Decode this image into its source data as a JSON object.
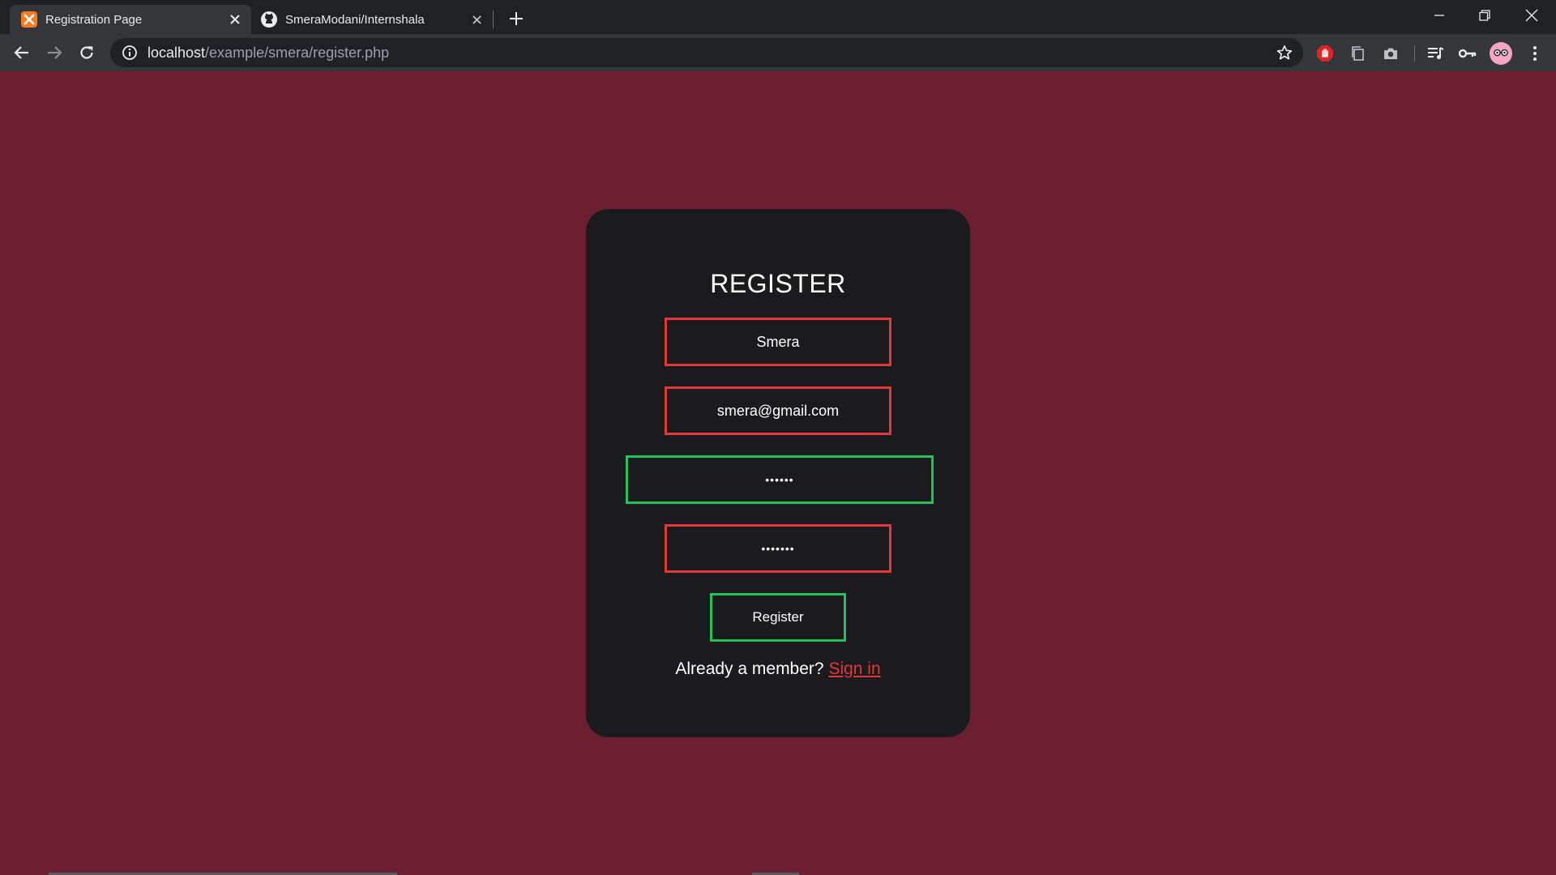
{
  "browser": {
    "tabs": [
      {
        "title": "Registration Page",
        "active": true,
        "favicon": "xampp-icon"
      },
      {
        "title": "SmeraModani/Internshala",
        "active": false,
        "favicon": "github-icon"
      }
    ],
    "address": {
      "host": "localhost",
      "path": "/example/smera/register.php"
    }
  },
  "page": {
    "heading": "REGISTER",
    "fields": {
      "username": "Smera",
      "email": "smera@gmail.com",
      "password": "••••••",
      "confirm_password": "•••••••"
    },
    "submit_label": "Register",
    "signin_prompt": "Already a member?",
    "signin_link": "Sign in"
  },
  "colors": {
    "page_background": "#6c1f31",
    "card_background": "#1b1b1d",
    "invalid_border": "#e0393b",
    "valid_border": "#27c15c"
  }
}
